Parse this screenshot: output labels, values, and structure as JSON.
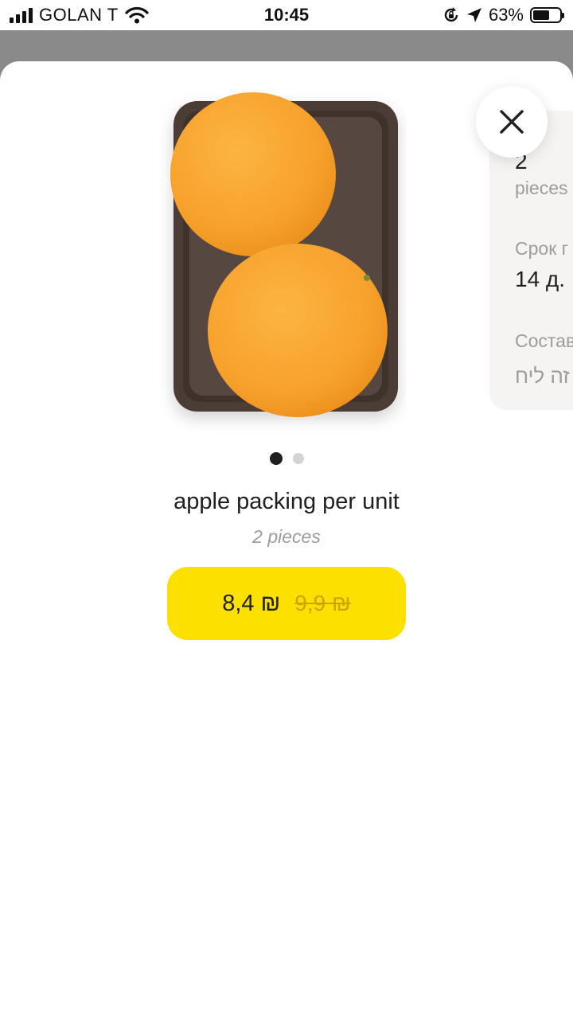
{
  "status_bar": {
    "carrier": "GOLAN T",
    "time": "10:45",
    "battery_percent_label": "63%",
    "battery_level": 0.63,
    "icons": [
      "signal-bars-icon",
      "wifi-icon",
      "rotation-lock-icon",
      "location-arrow-icon",
      "battery-icon"
    ]
  },
  "product": {
    "image_icon": "oranges-in-tray-photo",
    "name": "apple packing per unit",
    "quantity": "2 pieces",
    "gallery": {
      "count": 2,
      "active_index": 0
    }
  },
  "price": {
    "current": "8,4 ₪",
    "old": "9,9 ₪"
  },
  "info_card": {
    "quantity_value": "2",
    "quantity_unit": "pieces",
    "shelf_life_label": "Срок г",
    "shelf_life_value": "14 д.",
    "composition_label": "Состав",
    "composition_value": "זה ליח"
  },
  "close_button": {
    "icon": "close-icon"
  },
  "colors": {
    "accent": "#fce000",
    "text_primary": "#21201f",
    "text_secondary": "#9e9b98",
    "old_price": "#c9a600",
    "orange": "#f9a12b",
    "tray": "#4b3d35"
  }
}
